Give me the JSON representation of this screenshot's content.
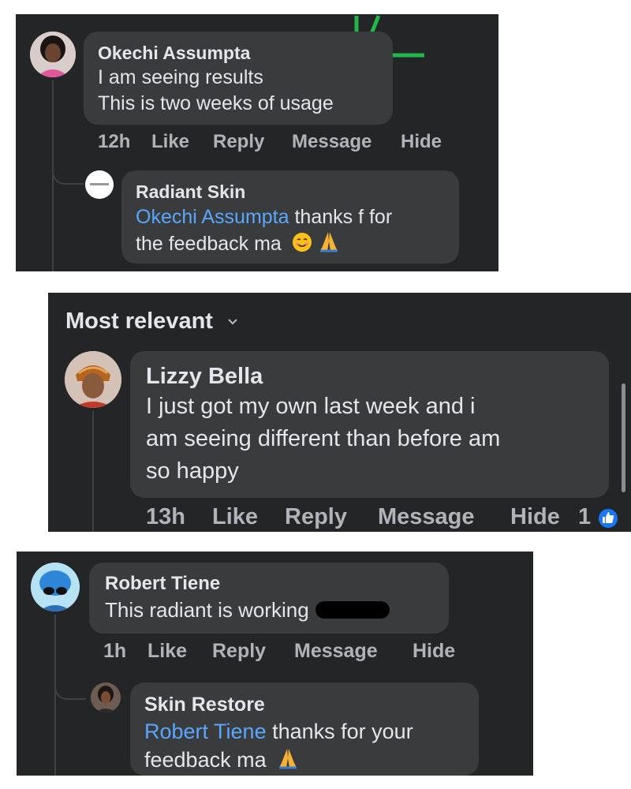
{
  "panel1": {
    "comment": {
      "author": "Okechi Assumpta",
      "lines": [
        "I am seeing results",
        "This is two weeks of usage"
      ],
      "time": "12h"
    },
    "reply": {
      "author": "Radiant Skin",
      "mention": "Okechi Assumpta",
      "text_part1": " thanks f for",
      "text_part2": "the feedback ma",
      "emojis": [
        "smiling-face",
        "folded-hands"
      ]
    }
  },
  "panel2": {
    "sort_label": "Most relevant",
    "comment": {
      "author": "Lizzy Bella",
      "lines": [
        "I just got my own last week and i",
        "am seeing different than before am",
        "so happy"
      ],
      "time": "13h",
      "like_count": "1"
    }
  },
  "panel3": {
    "comment": {
      "author": "Robert Tiene",
      "text": "This radiant is working",
      "time": "1h"
    },
    "reply": {
      "author": "Skin Restore",
      "mention": "Robert Tiene",
      "text_part1": " thanks for your",
      "text_part2": "feedback ma",
      "emojis": [
        "folded-hands"
      ]
    }
  },
  "actions": {
    "like": "Like",
    "reply": "Reply",
    "message": "Message",
    "hide": "Hide"
  },
  "colors": {
    "panel_bg": "#242526",
    "bubble_bg": "#3a3b3c",
    "text": "#e4e6eb",
    "muted": "#b0b3b8",
    "mention": "#5aa7ff",
    "like_badge": "#1877f2",
    "stray_mark": "#20b64a"
  }
}
